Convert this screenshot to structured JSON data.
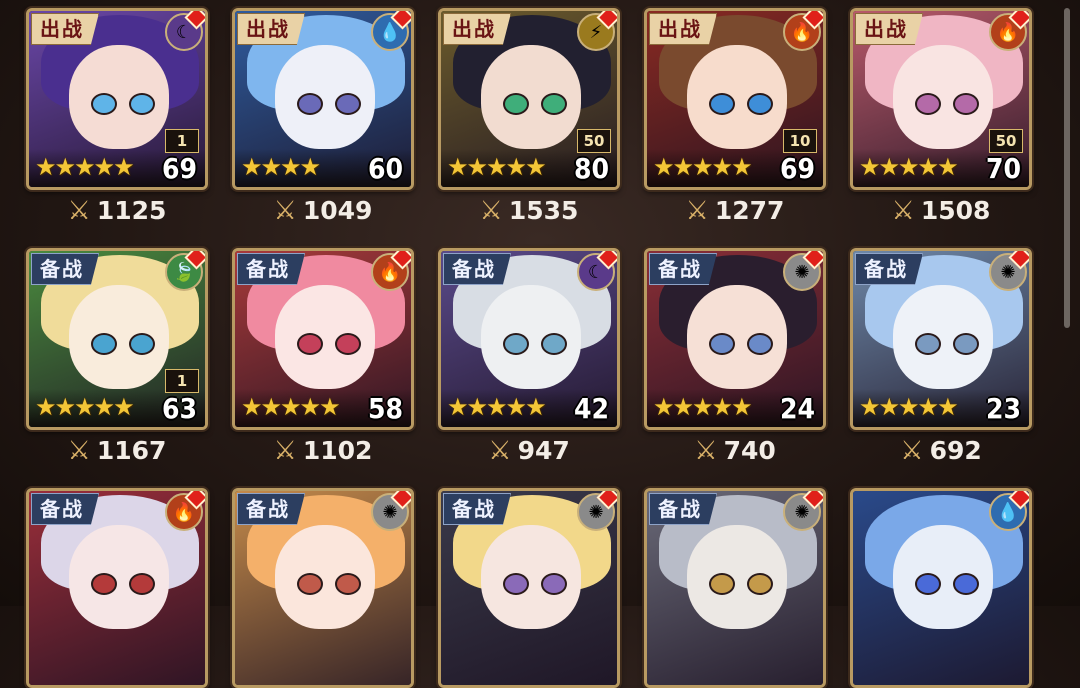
{
  "status_labels": {
    "deploy": "出战",
    "reserve": "备战"
  },
  "colors": {
    "gold_frame": "#b89a62",
    "alert": "#e0201a",
    "star": "#f3c637"
  },
  "heroes": [
    {
      "status": "出战",
      "element": "dark-moon-icon",
      "glyph": "☾",
      "elem_bg": "#5a3a8a",
      "rank": "1",
      "level": "69",
      "power": "1125",
      "stars": "★★★★★",
      "hair": "#4a2f8f",
      "skin": "#f5dcd4",
      "eyes": "#5fb4e8",
      "bg": "#6a47a8"
    },
    {
      "status": "出战",
      "element": "water-drop-icon",
      "glyph": "💧",
      "elem_bg": "#2e6cb0",
      "rank": "",
      "level": "60",
      "power": "1049",
      "stars": "★★★★",
      "hair": "#7fb6ee",
      "skin": "#eef0f8",
      "eyes": "#6a6ab8",
      "bg": "#2f5c9e"
    },
    {
      "status": "出战",
      "element": "lightning-icon",
      "glyph": "⚡",
      "elem_bg": "#9a7a1e",
      "rank": "50",
      "level": "80",
      "power": "1535",
      "stars": "★★★★★",
      "hair": "#222030",
      "skin": "#f2dcd0",
      "eyes": "#3fae7a",
      "bg": "#6b5b2c"
    },
    {
      "status": "出战",
      "element": "fire-icon",
      "glyph": "🔥",
      "elem_bg": "#b2401a",
      "rank": "10",
      "level": "69",
      "power": "1277",
      "stars": "★★★★★",
      "hair": "#7a4a2e",
      "skin": "#f7dccc",
      "eyes": "#3e8ed8",
      "bg": "#8a2a22"
    },
    {
      "status": "出战",
      "element": "fire-icon",
      "glyph": "🔥",
      "elem_bg": "#b2401a",
      "rank": "50",
      "level": "70",
      "power": "1508",
      "stars": "★★★★★",
      "hair": "#f0b6c4",
      "skin": "#f9e4e2",
      "eyes": "#b46aa8",
      "bg": "#b85a6a"
    },
    {
      "status": "备战",
      "element": "leaf-icon",
      "glyph": "🍃",
      "elem_bg": "#3d8a44",
      "rank": "1",
      "level": "63",
      "power": "1167",
      "stars": "★★★★★",
      "hair": "#f0dc9a",
      "skin": "#f9ecdc",
      "eyes": "#4aa4d0",
      "bg": "#4a8a3e"
    },
    {
      "status": "备战",
      "element": "fire-icon",
      "glyph": "🔥",
      "elem_bg": "#b2401a",
      "rank": "",
      "level": "58",
      "power": "1102",
      "stars": "★★★★★",
      "hair": "#f08aa0",
      "skin": "#fbe6e4",
      "eyes": "#c4405a",
      "bg": "#a83a3a"
    },
    {
      "status": "备战",
      "element": "dark-moon-icon",
      "glyph": "☾",
      "elem_bg": "#5a3a8a",
      "rank": "",
      "level": "42",
      "power": "947",
      "stars": "★★★★★",
      "hair": "#d8dde4",
      "skin": "#eef0f2",
      "eyes": "#6fa8c8",
      "bg": "#5a4a8a"
    },
    {
      "status": "备战",
      "element": "light-sun-icon",
      "glyph": "✺",
      "elem_bg": "#8a8a8a",
      "rank": "",
      "level": "24",
      "power": "740",
      "stars": "★★★★★",
      "hair": "#2a1e2e",
      "skin": "#f6e0d6",
      "eyes": "#6a8ac8",
      "bg": "#8a2e36"
    },
    {
      "status": "备战",
      "element": "light-sun-icon",
      "glyph": "✺",
      "elem_bg": "#8a8a8a",
      "rank": "",
      "level": "23",
      "power": "692",
      "stars": "★★★★★",
      "hair": "#a8c8ee",
      "skin": "#eef2f8",
      "eyes": "#7a9ac0",
      "bg": "#6e88a8"
    },
    {
      "status": "备战",
      "element": "fire-icon",
      "glyph": "🔥",
      "elem_bg": "#b2401a",
      "hair": "#dcd6e8",
      "skin": "#f6e6e6",
      "eyes": "#b43a3a",
      "bg": "#9a2e3a"
    },
    {
      "status": "备战",
      "element": "light-sun-icon",
      "glyph": "✺",
      "elem_bg": "#8a8a8a",
      "hair": "#f4b06a",
      "skin": "#fbe6dc",
      "eyes": "#c05a4a",
      "bg": "#c48a4a"
    },
    {
      "status": "备战",
      "element": "light-sun-icon",
      "glyph": "✺",
      "elem_bg": "#8a8a8a",
      "hair": "#f2d88a",
      "skin": "#f6e6e0",
      "eyes": "#8a6ab8",
      "bg": "#3a3a4a"
    },
    {
      "status": "备战",
      "element": "light-sun-icon",
      "glyph": "✺",
      "elem_bg": "#8a8a8a",
      "hair": "#b8bcc8",
      "skin": "#ece8e4",
      "eyes": "#c49a4a",
      "bg": "#6a6a78"
    },
    {
      "status": "",
      "element": "water-drop-icon",
      "glyph": "💧",
      "elem_bg": "#2e6cb0",
      "hair": "#7aa8e8",
      "skin": "#e8eef8",
      "eyes": "#4a6ad8",
      "bg": "#2a4a8a"
    }
  ]
}
